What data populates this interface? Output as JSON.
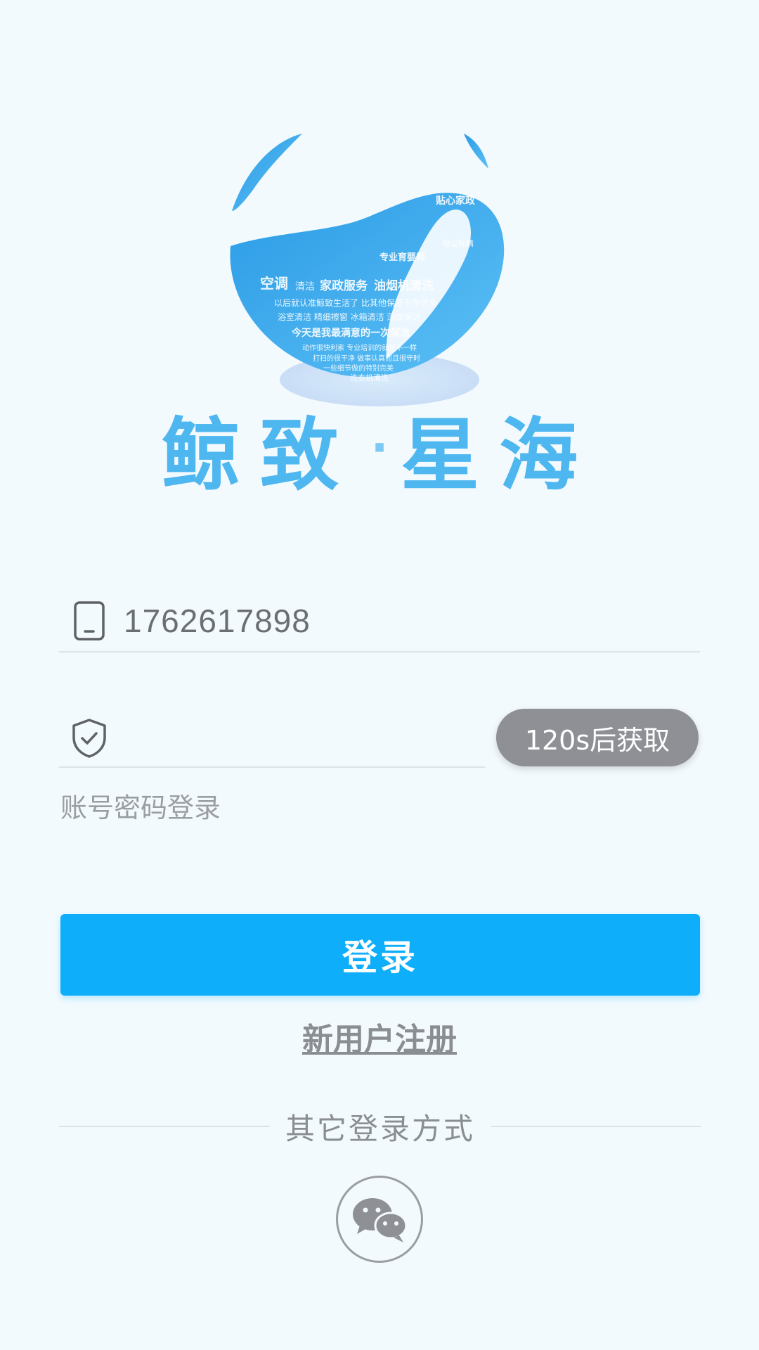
{
  "brand": {
    "name_part1": "鲸致",
    "separator": "·",
    "name_part2": "星海",
    "logo_words": [
      "贴心家政",
      "灶具清洁",
      "专业育婴师",
      "除尘除螨",
      "空调",
      "清洁",
      "家政服务",
      "油烟机清洗",
      "以后就认准鲸致生活了 比其他保洁干净很多",
      "浴室清洁",
      "精细擦窗",
      "冰箱清洁",
      "深度保洁",
      "今天是我最满意的一次保洁",
      "动作很快利索 专业培训的就是不一样",
      "打扫的很干净",
      "做事认真而且很守时",
      "一些细节做的特别完美",
      "洗衣机清洗"
    ],
    "accent_color": "#4fb7f0"
  },
  "login": {
    "phone_value": "1762617898",
    "code_placeholder": "",
    "countdown_label": "120s后获取",
    "account_login_label": "账号密码登录",
    "login_button_label": "登录",
    "register_label": "新用户注册",
    "other_methods_label": "其它登录方式"
  },
  "colors": {
    "background": "#f3fafe",
    "primary": "#0eaefa",
    "countdown_bg": "#8e9095"
  }
}
